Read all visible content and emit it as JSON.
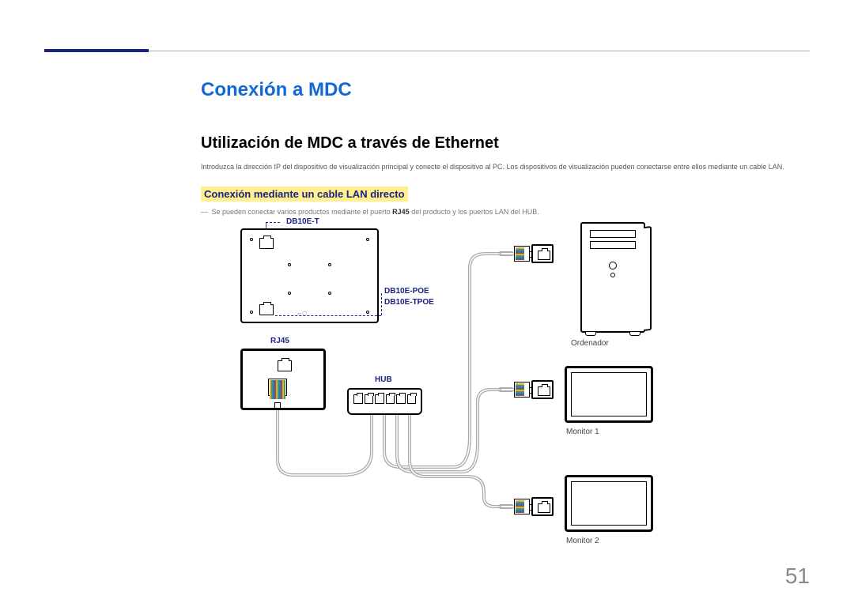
{
  "page": {
    "section_title": "Conexión a MDC",
    "sub_title": "Utilización de MDC a través de Ethernet",
    "intro_text": "Introduzca la dirección IP del dispositivo de visualización principal y conecte el dispositivo al PC. Los dispositivos de visualización pueden conectarse entre ellos mediante un cable LAN.",
    "highlight_heading": "Conexión mediante un cable LAN directo",
    "note_prefix": "―",
    "note_text_a": "Se pueden conectar varios productos mediante el puerto ",
    "note_bold": "RJ45",
    "note_text_b": " del producto y los puertos LAN del HUB.",
    "page_number": "51"
  },
  "diagram": {
    "callout_top": "DB10E-T",
    "callout_bottom_line1": "DB10E-POE",
    "callout_bottom_line2": "DB10E-TPOE",
    "rj45_label": "RJ45",
    "hub_label": "HUB",
    "computer_label": "Ordenador",
    "monitor1_label": "Monitor 1",
    "monitor2_label": "Monitor 2"
  }
}
